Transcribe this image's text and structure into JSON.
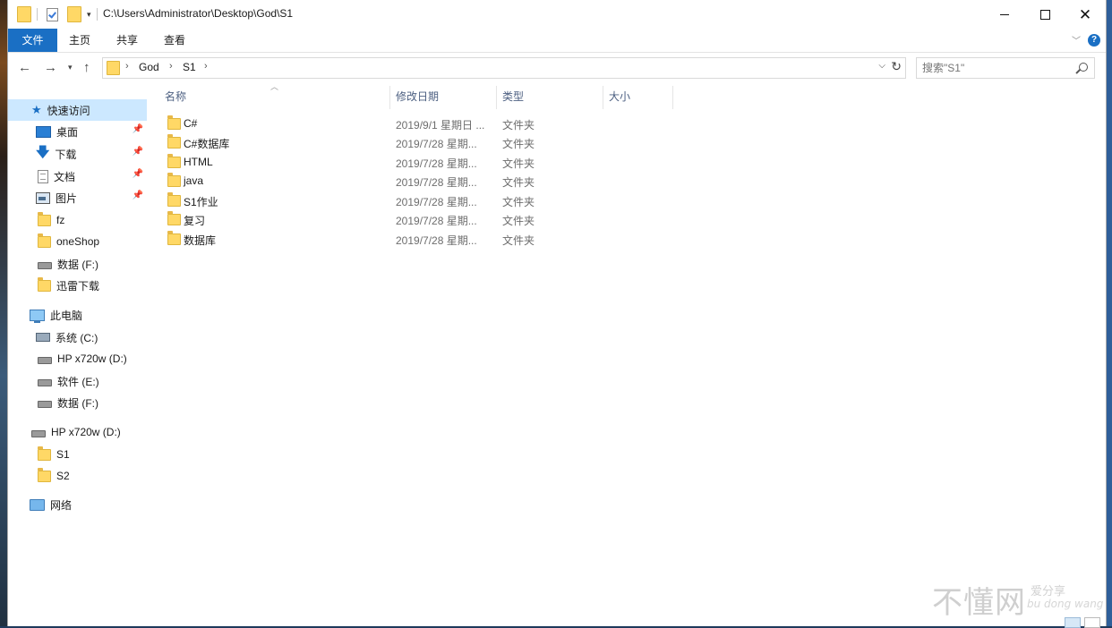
{
  "window": {
    "title_path": "C:\\Users\\Administrator\\Desktop\\God\\S1"
  },
  "ribbon": {
    "tabs": [
      "文件",
      "主页",
      "共享",
      "查看"
    ]
  },
  "navigation": {
    "breadcrumb": [
      "God",
      "S1"
    ],
    "search_placeholder": "搜索\"S1\""
  },
  "sidebar": {
    "quick_access": {
      "label": "快速访问",
      "items": [
        {
          "label": "桌面",
          "icon": "desktop-icon",
          "pinned": true
        },
        {
          "label": "下载",
          "icon": "download-icon",
          "pinned": true
        },
        {
          "label": "文档",
          "icon": "document-icon",
          "pinned": true
        },
        {
          "label": "图片",
          "icon": "pictures-icon",
          "pinned": true
        },
        {
          "label": "fz",
          "icon": "folder-icon"
        },
        {
          "label": "oneShop",
          "icon": "folder-icon"
        },
        {
          "label": "数据 (F:)",
          "icon": "drive-icon"
        },
        {
          "label": "迅雷下载",
          "icon": "folder-icon"
        }
      ]
    },
    "this_pc": {
      "label": "此电脑",
      "items": [
        {
          "label": "系统 (C:)",
          "icon": "system-drive-icon"
        },
        {
          "label": "HP x720w (D:)",
          "icon": "drive-icon"
        },
        {
          "label": "软件 (E:)",
          "icon": "drive-icon"
        },
        {
          "label": "数据 (F:)",
          "icon": "drive-icon"
        }
      ]
    },
    "usb_drive": {
      "label": "HP x720w (D:)",
      "items": [
        {
          "label": "S1",
          "icon": "folder-icon"
        },
        {
          "label": "S2",
          "icon": "folder-icon"
        }
      ]
    },
    "network": {
      "label": "网络"
    }
  },
  "columns": [
    "名称",
    "修改日期",
    "类型",
    "大小"
  ],
  "files": [
    {
      "name": "C#",
      "date": "2019/9/1 星期日 ...",
      "type": "文件夹",
      "size": ""
    },
    {
      "name": "C#数据库",
      "date": "2019/7/28 星期...",
      "type": "文件夹",
      "size": ""
    },
    {
      "name": "HTML",
      "date": "2019/7/28 星期...",
      "type": "文件夹",
      "size": ""
    },
    {
      "name": "java",
      "date": "2019/7/28 星期...",
      "type": "文件夹",
      "size": ""
    },
    {
      "name": "S1作业",
      "date": "2019/7/28 星期...",
      "type": "文件夹",
      "size": ""
    },
    {
      "name": "复习",
      "date": "2019/7/28 星期...",
      "type": "文件夹",
      "size": ""
    },
    {
      "name": "数据库",
      "date": "2019/7/28 星期...",
      "type": "文件夹",
      "size": ""
    }
  ],
  "watermark": {
    "main": "不懂网",
    "top": "爱分享",
    "bottom": "bu dong wang"
  }
}
